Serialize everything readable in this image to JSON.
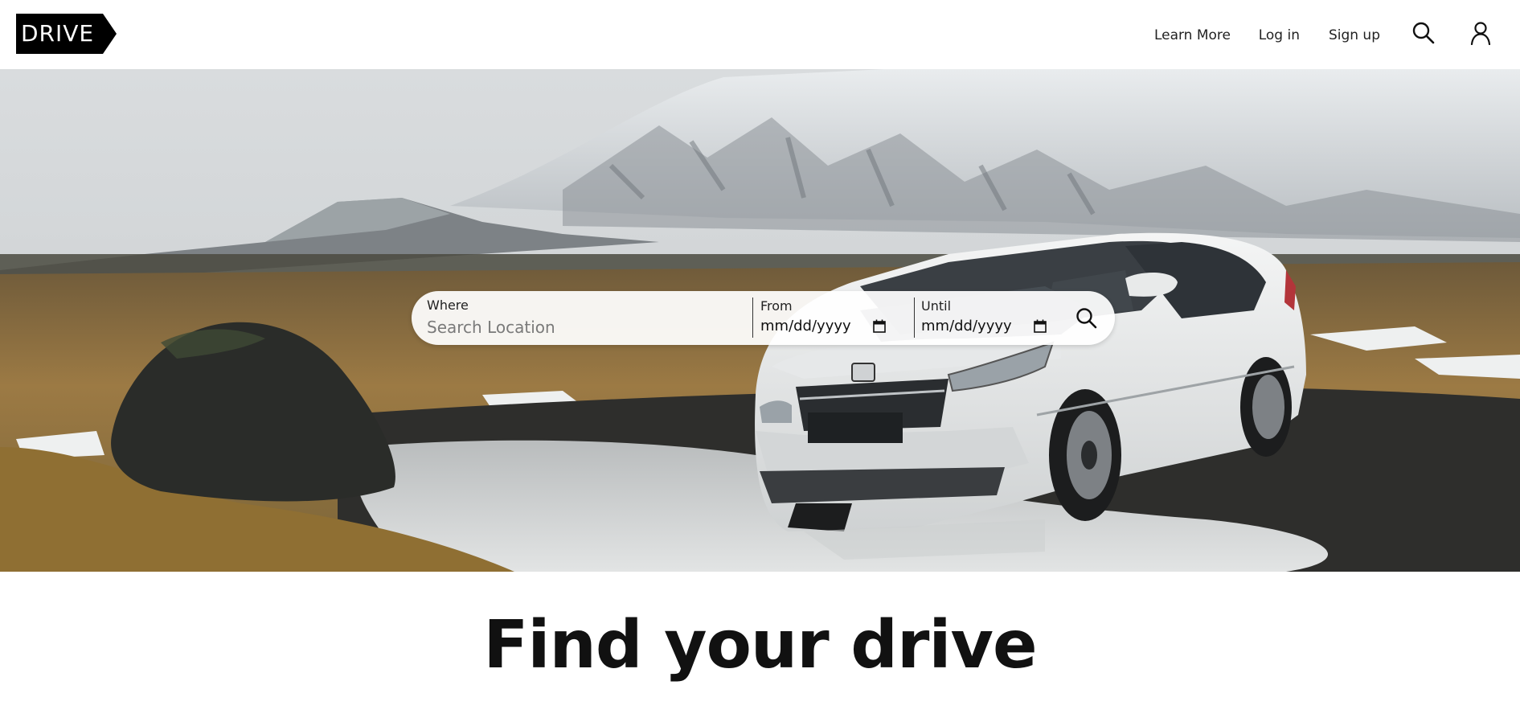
{
  "header": {
    "logo_text": "DRIVE",
    "nav": {
      "learn_more": "Learn More",
      "log_in": "Log in",
      "sign_up": "Sign up"
    },
    "icons": {
      "search": "search-icon",
      "account": "user-icon"
    }
  },
  "hero": {
    "image_subject": "white SUV parked on icy ground with snowy mountains behind"
  },
  "search": {
    "where_label": "Where",
    "where_placeholder": "Search Location",
    "where_value": "",
    "from_label": "From",
    "from_value": "mm/dd/yyyy",
    "until_label": "Until",
    "until_value": "mm/dd/yyyy",
    "submit_icon": "search-icon"
  },
  "main": {
    "headline": "Find your drive"
  },
  "colors": {
    "logo_bg": "#000000",
    "text": "#111111",
    "page_bg": "#ffffff"
  }
}
